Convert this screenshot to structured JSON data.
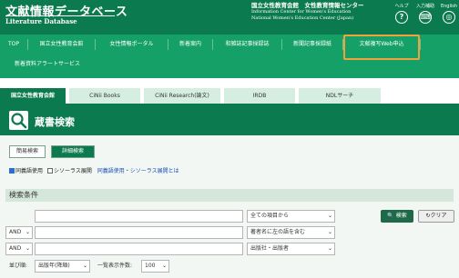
{
  "header": {
    "logo_jp": "文献情報データベース",
    "logo_en": "Literature Database",
    "org_jp": "国立女性教育会館　女性教育情報センター",
    "org_en_1": "Information Center for Women's Education",
    "org_en_2": "National Women's Education Center (Japan)",
    "help_label": "ヘルプ",
    "help_glyph": "?",
    "input_label": "入力補助",
    "input_glyph": "⌨",
    "english_label": "English",
    "english_glyph": "◎"
  },
  "nav": {
    "items": [
      "TOP",
      "国立女性教育会館",
      "女性情報ポータル",
      "新着案内",
      "和雑誌記事採録誌",
      "新聞記事採録紙",
      "文献複写Web申込",
      "新着資料アラートサービス"
    ]
  },
  "tabs": [
    "国立女性教育会館",
    "CiNii Books",
    "CiNii Research(論文)",
    "IRDB",
    "NDLサーチ"
  ],
  "page": {
    "title": "蔵書検索",
    "mode_simple": "簡易検索",
    "mode_detail": "詳細検索",
    "synonym_label": "同義語使用",
    "thesaurus_label": "シソーラス展開",
    "help_link": "同義語使用・シソーラス展開とは",
    "conditions_heading": "検索条件"
  },
  "form": {
    "field_options": [
      "全ての項目から",
      "著者名に左の語を含む",
      "出版社・出版者"
    ],
    "operators": [
      "AND",
      "AND"
    ],
    "search_button": "検索",
    "search_glyph": "🔍",
    "clear_button": "クリア",
    "clear_glyph": "↻",
    "sort_label": "並び順:",
    "sort_value": "出版年(降順)",
    "count_label": "一覧表示件数:",
    "count_value": "100"
  },
  "colors": {
    "header_green": "#0b7a4f",
    "nav_green": "#15a067",
    "highlight_orange": "#f0a33a"
  }
}
